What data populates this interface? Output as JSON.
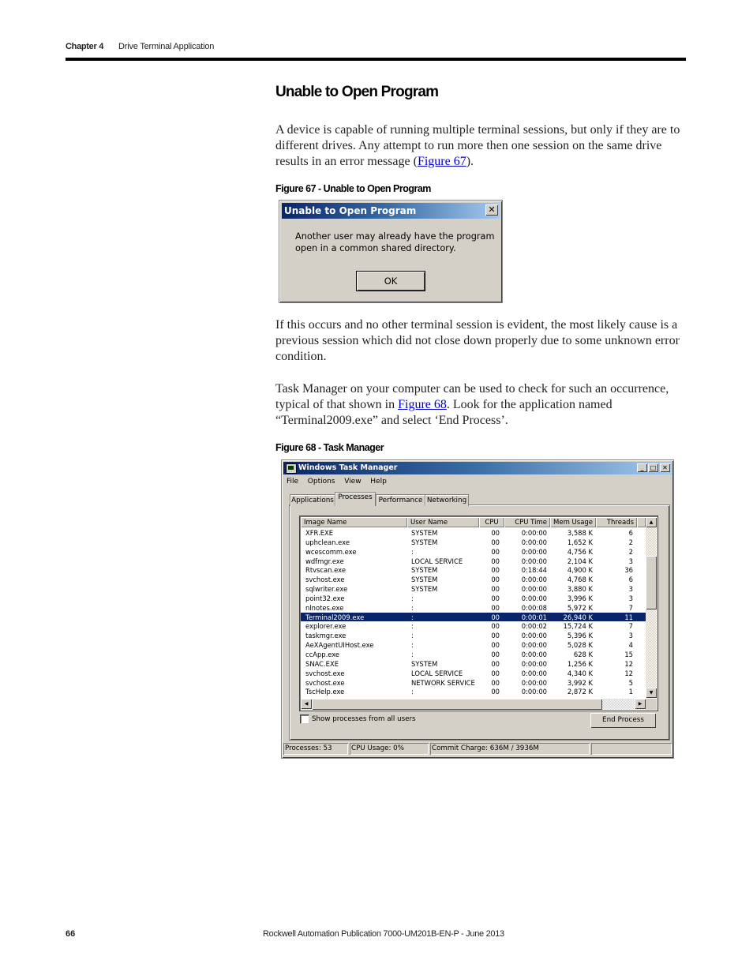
{
  "header": {
    "chapter": "Chapter 4",
    "title": "Drive Terminal Application"
  },
  "section": {
    "title": "Unable to Open Program",
    "para1": {
      "line1": "A device is capable of running multiple terminal sessions, but only if they are to",
      "line2": "different drives. Any attempt to run more then one session on the same drive",
      "line3_pre": "results in an error message (",
      "link": "Figure 67",
      "line3_post": ")."
    },
    "para2": {
      "line1": "If this occurs and no other terminal session is evident, the most likely cause is a",
      "line2": "previous session which did not close down properly due to some unknown error",
      "line3": "condition."
    },
    "para3": {
      "line1": "Task Manager on your computer can be used to check for such an occurrence,",
      "line2_pre": "typical of that shown in ",
      "link": "Figure 68",
      "line2_post": ". Look for the application named",
      "line3": "“Terminal2009.exe” and select ‘End Process’."
    }
  },
  "figure67": {
    "caption": "Figure 67 - Unable to Open Program",
    "dialog": {
      "title": "Unable to Open Program",
      "close_glyph": "✕",
      "message_line1": "Another user may already have the program",
      "message_line2": "open in a common shared directory.",
      "ok_label": "OK"
    }
  },
  "figure68": {
    "caption": "Figure 68 - Task Manager",
    "window": {
      "title": "Windows Task Manager",
      "min_glyph": "_",
      "max_glyph": "□",
      "close_glyph": "✕",
      "menu": [
        "File",
        "Options",
        "View",
        "Help"
      ],
      "tabs": [
        "Applications",
        "Processes",
        "Performance",
        "Networking"
      ],
      "active_tab": "Processes",
      "columns": [
        "Image Name",
        "User Name",
        "CPU",
        "CPU Time",
        "Mem Usage",
        "Threads"
      ],
      "rows": [
        {
          "name": "XFR.EXE",
          "user": "SYSTEM",
          "cpu": "00",
          "time": "0:00:00",
          "mem": "3,588 K",
          "threads": "6"
        },
        {
          "name": "uphclean.exe",
          "user": "SYSTEM",
          "cpu": "00",
          "time": "0:00:00",
          "mem": "1,652 K",
          "threads": "2"
        },
        {
          "name": "wcescomm.exe",
          "user": ":",
          "cpu": "00",
          "time": "0:00:00",
          "mem": "4,756 K",
          "threads": "2"
        },
        {
          "name": "wdfmgr.exe",
          "user": "LOCAL SERVICE",
          "cpu": "00",
          "time": "0:00:00",
          "mem": "2,104 K",
          "threads": "3"
        },
        {
          "name": "Rtvscan.exe",
          "user": "SYSTEM",
          "cpu": "00",
          "time": "0:18:44",
          "mem": "4,900 K",
          "threads": "36"
        },
        {
          "name": "svchost.exe",
          "user": "SYSTEM",
          "cpu": "00",
          "time": "0:00:00",
          "mem": "4,768 K",
          "threads": "6"
        },
        {
          "name": "sqlwriter.exe",
          "user": "SYSTEM",
          "cpu": "00",
          "time": "0:00:00",
          "mem": "3,880 K",
          "threads": "3"
        },
        {
          "name": "point32.exe",
          "user": ":",
          "cpu": "00",
          "time": "0:00:00",
          "mem": "3,996 K",
          "threads": "3"
        },
        {
          "name": "nlnotes.exe",
          "user": ":",
          "cpu": "00",
          "time": "0:00:08",
          "mem": "5,972 K",
          "threads": "7"
        },
        {
          "name": "Terminal2009.exe",
          "user": ":",
          "cpu": "00",
          "time": "0:00:01",
          "mem": "26,940 K",
          "threads": "11",
          "selected": true
        },
        {
          "name": "explorer.exe",
          "user": ":",
          "cpu": "00",
          "time": "0:00:02",
          "mem": "15,724 K",
          "threads": "7"
        },
        {
          "name": "taskmgr.exe",
          "user": ":",
          "cpu": "00",
          "time": "0:00:00",
          "mem": "5,396 K",
          "threads": "3"
        },
        {
          "name": "AeXAgentUIHost.exe",
          "user": ":",
          "cpu": "00",
          "time": "0:00:00",
          "mem": "5,028 K",
          "threads": "4"
        },
        {
          "name": "ccApp.exe",
          "user": ":",
          "cpu": "00",
          "time": "0:00:00",
          "mem": "628 K",
          "threads": "15"
        },
        {
          "name": "SNAC.EXE",
          "user": "SYSTEM",
          "cpu": "00",
          "time": "0:00:00",
          "mem": "1,256 K",
          "threads": "12"
        },
        {
          "name": "svchost.exe",
          "user": "LOCAL SERVICE",
          "cpu": "00",
          "time": "0:00:00",
          "mem": "4,340 K",
          "threads": "12"
        },
        {
          "name": "svchost.exe",
          "user": "NETWORK SERVICE",
          "cpu": "00",
          "time": "0:00:00",
          "mem": "3,992 K",
          "threads": "5"
        },
        {
          "name": "TscHelp.exe",
          "user": ":",
          "cpu": "00",
          "time": "0:00:00",
          "mem": "2,872 K",
          "threads": "1"
        }
      ],
      "show_all_users_label": "Show processes from all users",
      "show_all_users_checked": false,
      "end_process_label": "End Process",
      "status": {
        "processes": "Processes: 53",
        "cpu_usage": "CPU Usage: 0%",
        "commit_charge": "Commit Charge: 636M / 3936M"
      },
      "scroll_glyphs": {
        "up": "▲",
        "down": "▼",
        "left": "◀",
        "right": "▶"
      }
    }
  },
  "footer": {
    "page_number": "66",
    "publication": "Rockwell Automation Publication 7000-UM201B-EN-P - June 2013"
  }
}
